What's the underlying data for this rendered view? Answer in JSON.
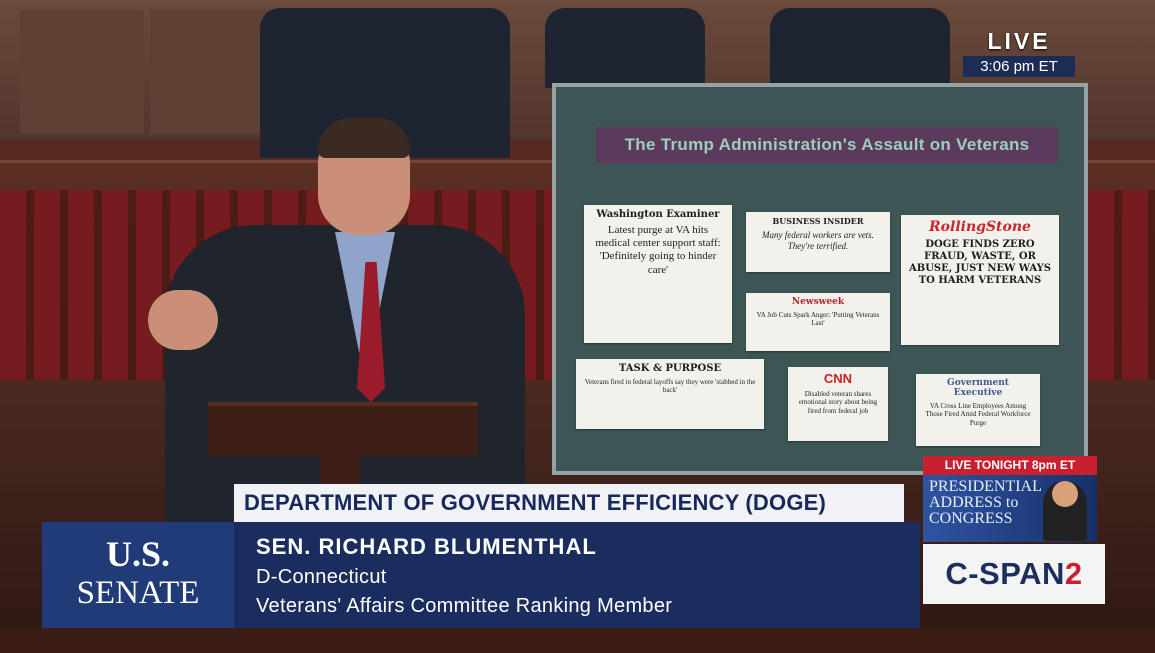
{
  "live": {
    "label": "LIVE",
    "time": "3:06 pm ET"
  },
  "board": {
    "title": "The Trump Administration's Assault on Veterans",
    "clips": [
      {
        "pub": "Washington Examiner",
        "head": "Latest purge at VA hits medical center support staff: 'Definitely going to hinder care'"
      },
      {
        "pub": "BUSINESS INSIDER",
        "head": "Many federal workers are vets. They're terrified."
      },
      {
        "pub": "RollingStone",
        "head": "DOGE FINDS ZERO FRAUD, WASTE, OR ABUSE, JUST NEW WAYS TO HARM VETERANS"
      },
      {
        "pub": "Newsweek",
        "head": "VA Job Cuts Spark Anger: 'Putting Veterans Last'"
      },
      {
        "pub": "TASK & PURPOSE",
        "head": "Veterans fired in federal layoffs say they were 'stabbed in the back'"
      },
      {
        "pub": "CNN",
        "head": "Disabled veteran shares emotional story about being fired from federal job"
      },
      {
        "pub": "Government Executive",
        "head": "VA Cross Line Employees Among Those Fired Amid Federal Workforce Purge"
      }
    ]
  },
  "promo": {
    "heading": "LIVE TONIGHT 8pm ET",
    "text": "PRESIDENTIAL ADDRESS to CONGRESS"
  },
  "network": {
    "name_a": "C-SPAN",
    "name_b": "2"
  },
  "lower_third": {
    "topic": "DEPARTMENT OF GOVERNMENT EFFICIENCY (DOGE)",
    "name": "SEN. RICHARD BLUMENTHAL",
    "party": "D-Connecticut",
    "role": "Veterans' Affairs Committee Ranking Member",
    "chamber_line1": "U.S.",
    "chamber_line2": "SENATE"
  }
}
